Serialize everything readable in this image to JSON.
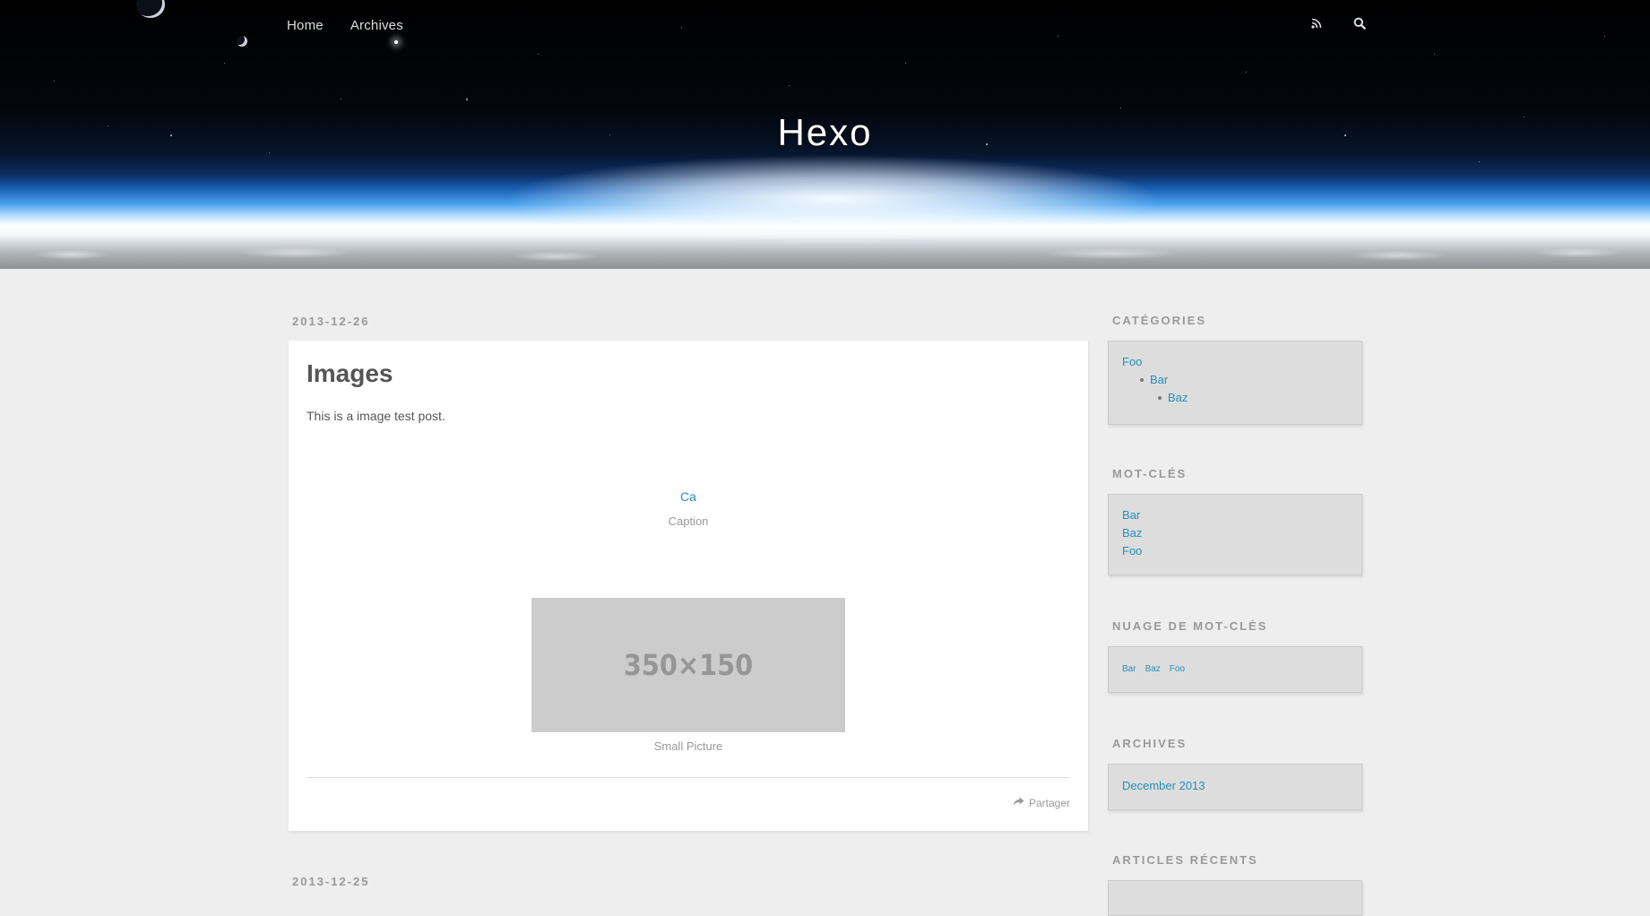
{
  "header": {
    "nav": [
      {
        "label": "Home"
      },
      {
        "label": "Archives"
      }
    ],
    "icons": [
      "rss-icon",
      "search-icon"
    ],
    "title": "Hexo"
  },
  "articles": [
    {
      "date": "2013-12-26",
      "title": "Images",
      "text": "This is a image test post.",
      "broken_image_alt": "Caption",
      "caption_1": "Caption",
      "placeholder_text": "350×150",
      "caption_2": "Small Picture",
      "share_label": "Partager"
    },
    {
      "date": "2013-12-25"
    }
  ],
  "sidebar": {
    "categories": {
      "title": "CATÉGORIES",
      "items": [
        {
          "label": "Foo",
          "level": 0
        },
        {
          "label": "Bar",
          "level": 1
        },
        {
          "label": "Baz",
          "level": 2
        }
      ]
    },
    "tags": {
      "title": "MOT-CLÉS",
      "items": [
        "Bar",
        "Baz",
        "Foo"
      ]
    },
    "tag_cloud": {
      "title": "NUAGE DE MOT-CLÉS",
      "items": [
        "Bar",
        "Baz",
        "Foo"
      ]
    },
    "archives": {
      "title": "ARCHIVES",
      "items": [
        "December 2013"
      ]
    },
    "recent": {
      "title": "ARTICLES RÉCENTS"
    }
  },
  "colors": {
    "link": "#258fb8",
    "background": "#eeeeee",
    "widget_background": "#dddddd",
    "muted_text": "#999999"
  }
}
